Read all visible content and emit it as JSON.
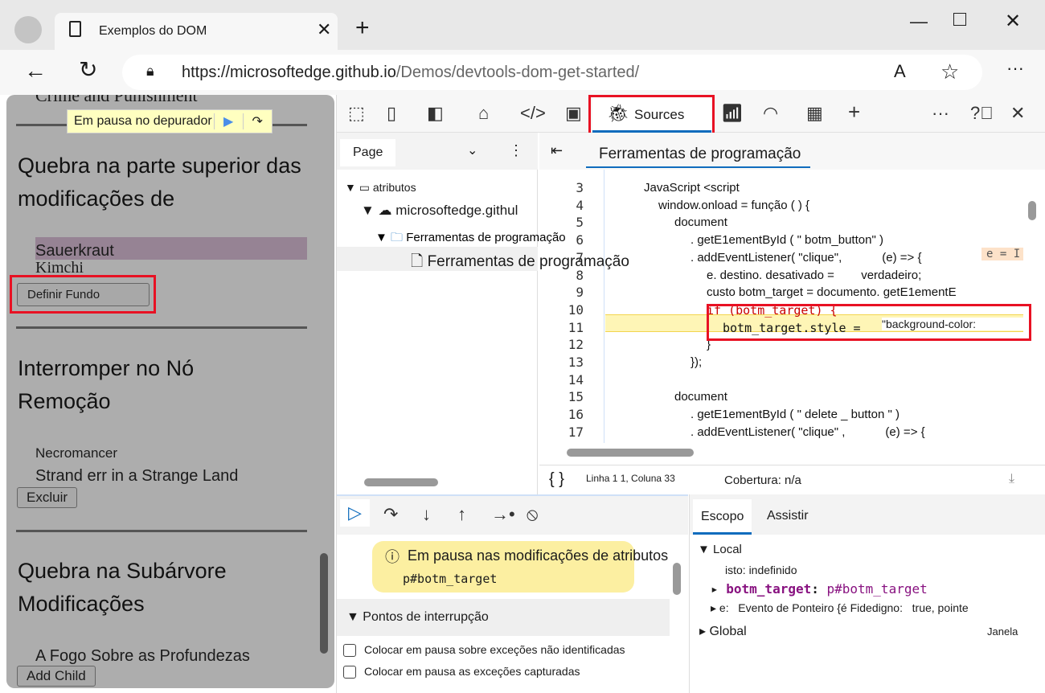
{
  "browser": {
    "tab_title": "Exemplos do DOM",
    "url_host": "https://microsoftedge.github.io",
    "url_path": "/Demos/devtools-dom-get-started/"
  },
  "page": {
    "cut_title": "Crime and Punishment",
    "paused_label": "Em pausa no depurador",
    "section1_title": "Quebra na parte superior das modificações de",
    "item_sauerkraut": "Sauerkraut",
    "item_kimchi": "Kimchi",
    "set_bg_button": "Definir Fundo",
    "section2_title": "Interromper no Nó Remoção",
    "item_necromancer": "Necromancer",
    "item_stranger": "Strand err in a Strange Land",
    "delete_button": "Excluir",
    "section3_title": "Quebra na Subárvore Modificações",
    "item_fire": "A Fogo Sobre as Profundezas",
    "add_child_button": "Add Child"
  },
  "devtools": {
    "sources_tab": "Sources",
    "navigator": {
      "tab": "Page",
      "tree": [
        "atributos",
        "microsoftedge.githul",
        "Ferramentas de programação",
        "Ferramentas de programação"
      ]
    },
    "editor_tab": "Ferramentas de programação",
    "code": [
      {
        "n": "3",
        "t": "JavaScript <script"
      },
      {
        "n": "4",
        "t": "window.onload = função ( ) {"
      },
      {
        "n": "5",
        "t": "document"
      },
      {
        "n": "6",
        "t": ". getE1ementById ( \" botm_button\" )"
      },
      {
        "n": "7",
        "t": ". addEventListener( \"clique\",            (e) => {"
      },
      {
        "n": "8",
        "t": "e. destino. desativado =        verdadeiro;"
      },
      {
        "n": "9",
        "t": "custo botm_target = documento. getE1ementE"
      },
      {
        "n": "10",
        "t": "if (botm_target) {"
      },
      {
        "n": "11",
        "t": "botm_target.style = "
      },
      {
        "n": "12",
        "t": "}"
      },
      {
        "n": "13",
        "t": "});"
      },
      {
        "n": "14",
        "t": ""
      },
      {
        "n": "15",
        "t": "document"
      },
      {
        "n": "16",
        "t": ". getE1ementById ( \" delete _ button \" )"
      },
      {
        "n": "17",
        "t": ". addEventListener( \"clique\" ,            (e) => {"
      }
    ],
    "inline_value": "e = I",
    "line11_string": "\"background-color:",
    "status": {
      "position": "Linha 1 1, Coluna 33",
      "coverage": "Cobertura: n/a"
    },
    "paused": {
      "message": "Em pausa nas modificações de atributos",
      "target": "p#botm_target"
    },
    "breakpoints": {
      "title": "Pontos de interrupção",
      "options": [
        "Colocar em pausa sobre exceções não identificadas",
        "Colocar em pausa as exceções capturadas"
      ]
    },
    "scope": {
      "tabs": [
        "Escopo",
        "Assistir"
      ],
      "local": "Local",
      "this": "isto: indefinido",
      "botm_key": "botm_target",
      "botm_val": "p#botm_target",
      "e_key": "e:",
      "e_val": "Evento de Ponteiro {é Fidedigno:",
      "e_val2": "true, pointe",
      "global": "Global",
      "global_val": "Janela"
    }
  }
}
